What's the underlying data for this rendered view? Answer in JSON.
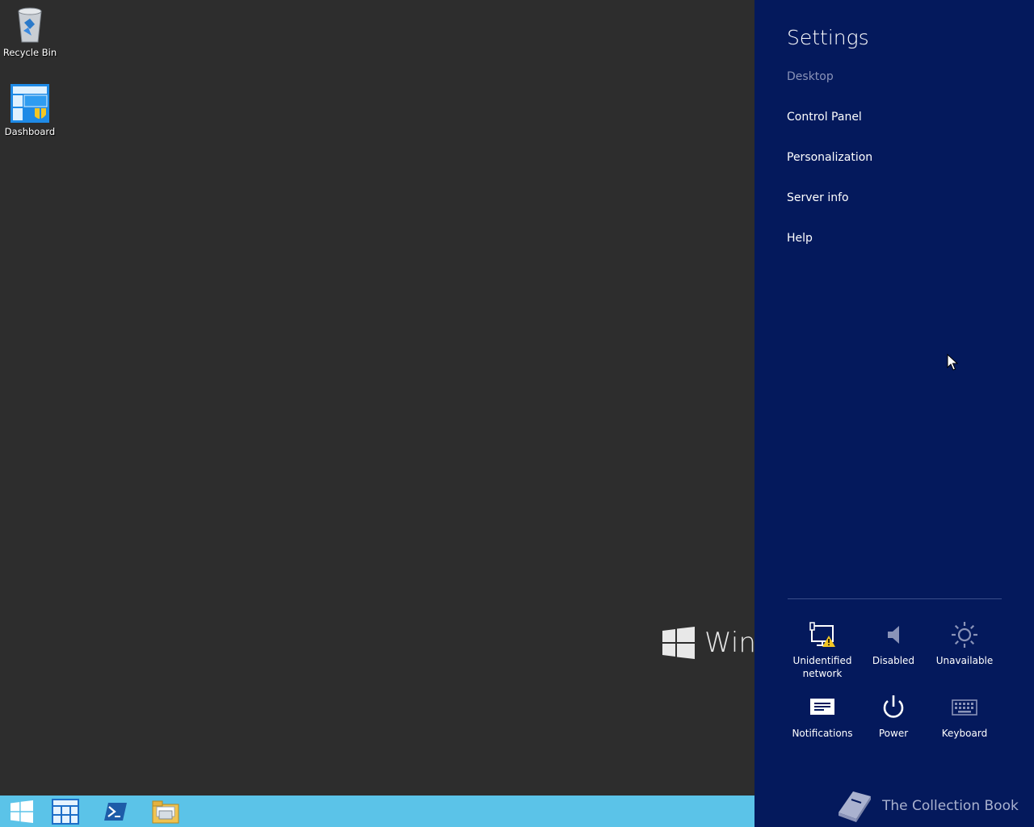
{
  "desktop": {
    "icons": [
      {
        "label": "Recycle Bin",
        "icon": "recycle-bin-icon"
      },
      {
        "label": "Dashboard",
        "icon": "dashboard-icon"
      }
    ],
    "watermark_text": "Wind"
  },
  "taskbar": {
    "items": [
      {
        "name": "start",
        "icon": "windows-logo-icon"
      },
      {
        "name": "server-manager",
        "icon": "server-manager-icon"
      },
      {
        "name": "powershell",
        "icon": "powershell-icon"
      },
      {
        "name": "file-explorer",
        "icon": "folder-icon"
      }
    ],
    "color": "#5bc3e8"
  },
  "settings": {
    "title": "Settings",
    "menu": [
      "Desktop",
      "Control Panel",
      "Personalization",
      "Server info",
      "Help"
    ],
    "tiles": [
      {
        "label": "Unidentified network",
        "icon": "network-warning-icon"
      },
      {
        "label": "Disabled",
        "icon": "speaker-icon"
      },
      {
        "label": "Unavailable",
        "icon": "brightness-icon"
      },
      {
        "label": "Notifications",
        "icon": "notifications-icon"
      },
      {
        "label": "Power",
        "icon": "power-icon"
      },
      {
        "label": "Keyboard",
        "icon": "keyboard-icon"
      }
    ],
    "brand": "The Collection Book",
    "background_color": "#04195c"
  }
}
